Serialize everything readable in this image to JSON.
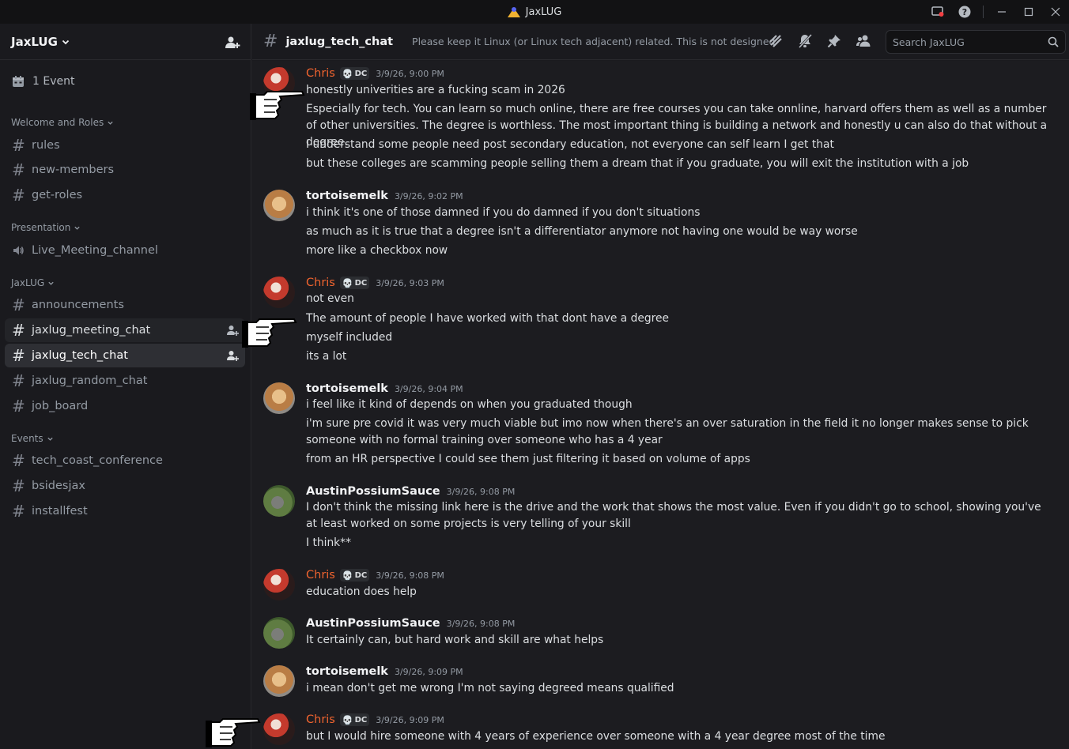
{
  "window": {
    "title": "JaxLUG"
  },
  "sidebar": {
    "server_name": "JaxLUG",
    "events_label": "1 Event",
    "categories": [
      {
        "label": "Welcome and Roles",
        "channels": [
          {
            "name": "rules",
            "type": "text"
          },
          {
            "name": "new-members",
            "type": "text"
          },
          {
            "name": "get-roles",
            "type": "text"
          }
        ]
      },
      {
        "label": "Presentation",
        "channels": [
          {
            "name": "Live_Meeting_channel",
            "type": "voice"
          }
        ]
      },
      {
        "label": "JaxLUG",
        "channels": [
          {
            "name": "announcements",
            "type": "text"
          },
          {
            "name": "jaxlug_meeting_chat",
            "type": "text"
          },
          {
            "name": "jaxlug_tech_chat",
            "type": "text",
            "selected": true
          },
          {
            "name": "jaxlug_random_chat",
            "type": "text"
          },
          {
            "name": "job_board",
            "type": "text"
          }
        ]
      },
      {
        "label": "Events",
        "channels": [
          {
            "name": "tech_coast_conference",
            "type": "text"
          },
          {
            "name": "bsidesjax",
            "type": "text"
          },
          {
            "name": "installfest",
            "type": "text"
          }
        ]
      }
    ]
  },
  "header": {
    "channel_name": "jaxlug_tech_chat",
    "topic": "Please keep it Linux (or Linux tech adjacent) related. This is not designed troubl...",
    "search_placeholder": "Search JaxLUG"
  },
  "messages": [
    {
      "author": "Chris",
      "tag": "DC",
      "time": "3/9/26, 9:00 PM",
      "lines": [
        "honestly univerities are a fucking scam in 2026",
        "Especially for tech. You can learn so much online, there are free courses you can take onnline, harvard offers them as well as a number of other universities. The degree is worthless. The most important thing is building a network and honestly u can also do that without a degree.",
        "I understand some people need post secondary education, not everyone can self learn I get that",
        "but these colleges are scamming people selling them a dream that if you graduate, you will exit the institution with a job"
      ]
    },
    {
      "author": "tortoisemelk",
      "time": "3/9/26, 9:02 PM",
      "lines": [
        "i think it's one of those damned if you do damned if you don't situations",
        "as much as it is true that a degree isn't a differentiator anymore not having one would be way worse",
        "more like a checkbox now"
      ]
    },
    {
      "author": "Chris",
      "tag": "DC",
      "time": "3/9/26, 9:03 PM",
      "lines": [
        "not even",
        "The amount of people I have worked with that dont have a degree",
        "myself included",
        "its a lot"
      ]
    },
    {
      "author": "tortoisemelk",
      "time": "3/9/26, 9:04 PM",
      "lines": [
        "i feel like it kind of depends on when you graduated though",
        "i'm sure pre covid it was very much viable but imo now when there's an over saturation in the field it no longer makes sense to pick someone with no formal training over someone who has a 4 year",
        "from an HR perspective I could see them just filtering it based on volume of apps"
      ]
    },
    {
      "author": "AustinPossiumSauce",
      "time": "3/9/26, 9:08 PM",
      "lines": [
        "I don't think the missing link here is the drive and the work that shows the most value. Even if you didn't go to school, showing you've at least worked on some projects is very telling of your skill",
        "I think**"
      ]
    },
    {
      "author": "Chris",
      "tag": "DC",
      "time": "3/9/26, 9:08 PM",
      "lines": [
        "education does help"
      ]
    },
    {
      "author": "AustinPossiumSauce",
      "time": "3/9/26, 9:08 PM",
      "lines": [
        "It certainly can, but hard work and skill are what helps"
      ]
    },
    {
      "author": "tortoisemelk",
      "time": "3/9/26, 9:09 PM",
      "lines": [
        "i mean don't get me wrong I'm not saying degreed means qualified"
      ]
    },
    {
      "author": "Chris",
      "tag": "DC",
      "time": "3/9/26, 9:09 PM",
      "lines": [
        "but I would hire someone with 4 years of experience over someone with a 4 year degree most of the time"
      ]
    }
  ],
  "colors": {
    "accent": "#f0642f",
    "background": "#1a1a1e"
  },
  "icons": [
    "calendar-icon",
    "invite-icon",
    "thread-icon",
    "mute-icon",
    "pin-icon",
    "members-icon",
    "search-icon",
    "pointing-hand-cursor"
  ]
}
